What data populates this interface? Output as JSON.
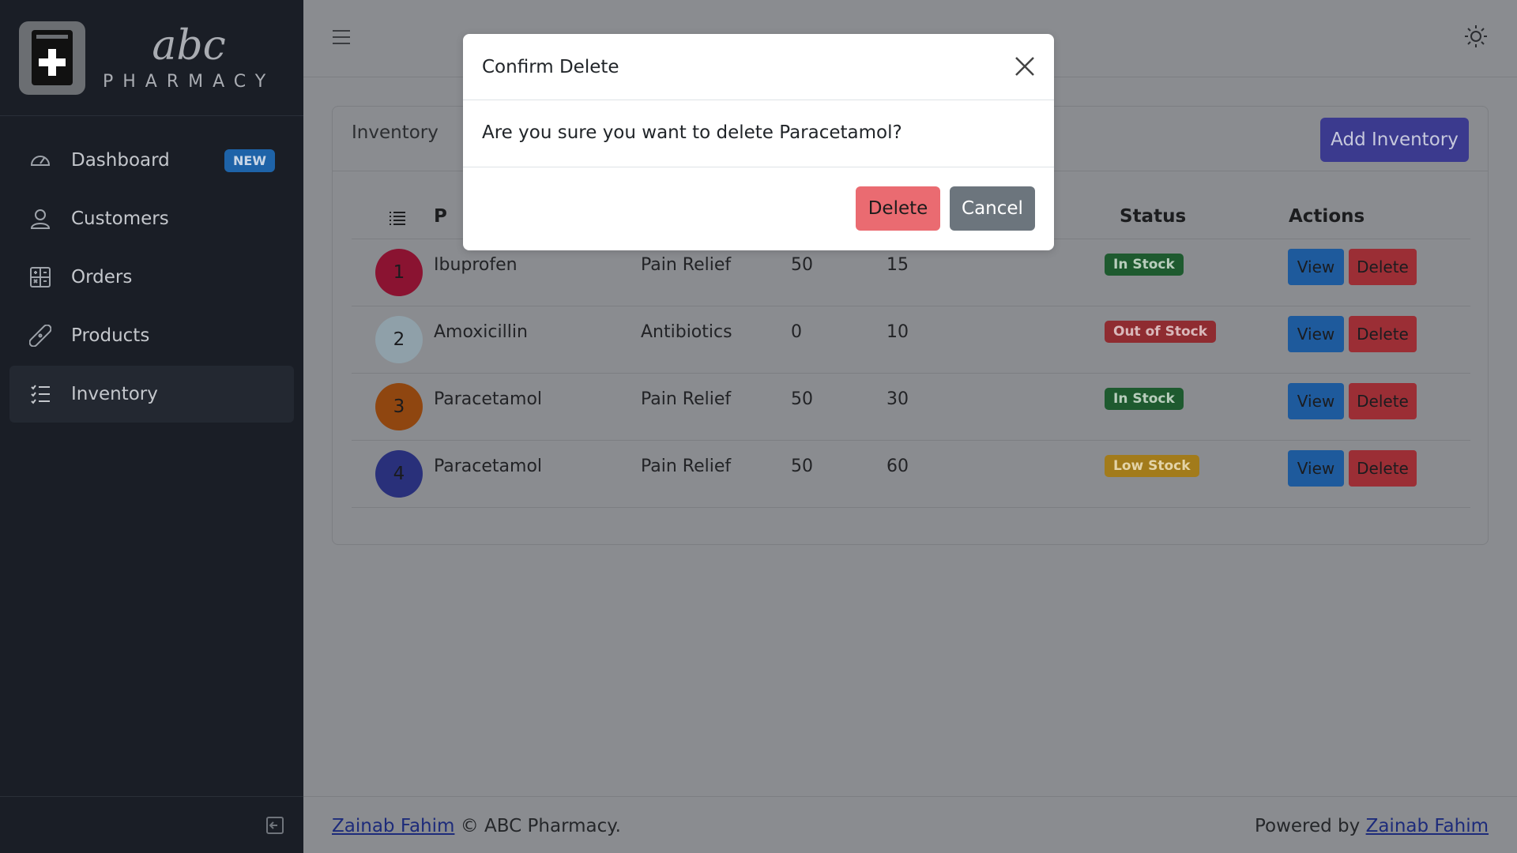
{
  "brand": {
    "name": "abc",
    "subtitle": "PHARMACY"
  },
  "sidebar": {
    "items": [
      {
        "label": "Dashboard",
        "icon": "speedometer-icon",
        "badge": "NEW"
      },
      {
        "label": "Customers",
        "icon": "person-icon"
      },
      {
        "label": "Orders",
        "icon": "calculator-icon"
      },
      {
        "label": "Products",
        "icon": "bandage-icon"
      },
      {
        "label": "Inventory",
        "icon": "list-icon",
        "active": true
      }
    ]
  },
  "card": {
    "title": "Inventory",
    "add_button": "Add Inventory"
  },
  "table": {
    "headers": [
      "P",
      "Status",
      "Actions"
    ],
    "rows": [
      {
        "num": "1",
        "avatar_color": "#8a1331",
        "name": "Ibuprofen",
        "category": "Pain Relief",
        "qty": "50",
        "col4": "15",
        "status": "In Stock",
        "status_bg": "#1e5a2f",
        "status_fg": "#b8cdbc"
      },
      {
        "num": "2",
        "avatar_color": "#8fa0a9",
        "name": "Amoxicillin",
        "category": "Antibiotics",
        "qty": "0",
        "col4": "10",
        "status": "Out of Stock",
        "status_bg": "#8f2c31",
        "status_fg": "#d9b8ba"
      },
      {
        "num": "3",
        "avatar_color": "#8f4610",
        "name": "Paracetamol",
        "category": "Pain Relief",
        "qty": "50",
        "col4": "30",
        "status": "In Stock",
        "status_bg": "#1e5a2f",
        "status_fg": "#b8cdbc"
      },
      {
        "num": "4",
        "avatar_color": "#29307a",
        "name": "Paracetamol",
        "category": "Pain Relief",
        "qty": "50",
        "col4": "60",
        "status": "Low Stock",
        "status_bg": "#a27b1b",
        "status_fg": "#e3d3a7"
      }
    ],
    "view_label": "View",
    "delete_label": "Delete"
  },
  "footer": {
    "author": "Zainab Fahim",
    "copyright": "© ABC Pharmacy.",
    "powered_by": "Powered by",
    "powered_author": "Zainab Fahim"
  },
  "modal": {
    "title": "Confirm Delete",
    "message": "Are you sure you want to delete Paracetamol?",
    "delete_label": "Delete",
    "cancel_label": "Cancel"
  }
}
